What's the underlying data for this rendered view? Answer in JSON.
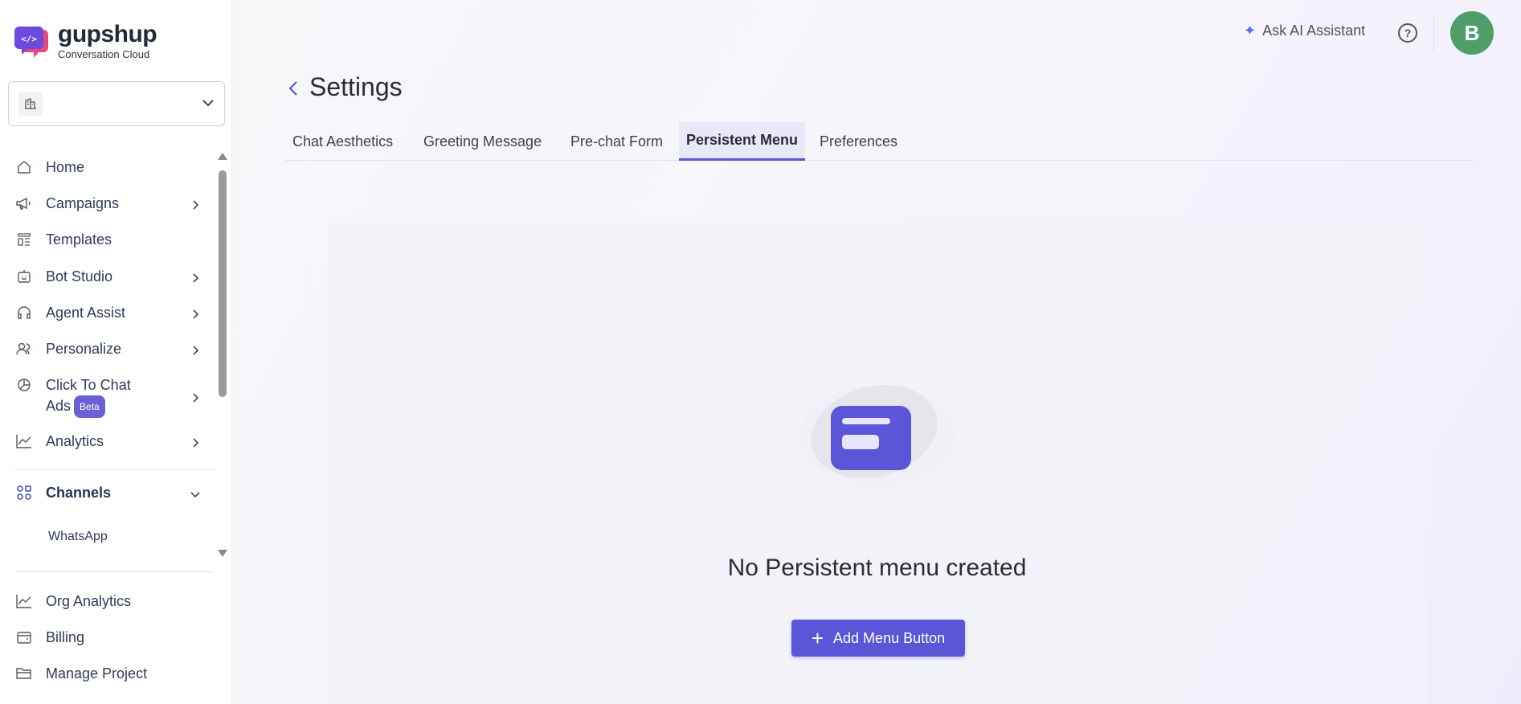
{
  "brand": {
    "name": "gupshup",
    "tagline": "Conversation Cloud",
    "logo_colors": [
      "#6a4bdc",
      "#e8457a"
    ]
  },
  "org_selector": {
    "value": "",
    "icon": "building-icon"
  },
  "sidebar": {
    "items": [
      {
        "label": "Home",
        "icon": "home-icon",
        "has_submenu": false
      },
      {
        "label": "Campaigns",
        "icon": "megaphone-icon",
        "has_submenu": true
      },
      {
        "label": "Templates",
        "icon": "templates-icon",
        "has_submenu": false
      },
      {
        "label": "Bot Studio",
        "icon": "bot-icon",
        "has_submenu": true
      },
      {
        "label": "Agent Assist",
        "icon": "headset-icon",
        "has_submenu": true
      },
      {
        "label": "Personalize",
        "icon": "users-icon",
        "has_submenu": true
      },
      {
        "label_line1": "Click To Chat",
        "label_line2": "Ads",
        "badge": "Beta",
        "icon": "pie-chart-icon",
        "has_submenu": true
      },
      {
        "label": "Analytics",
        "icon": "line-chart-icon",
        "has_submenu": true
      }
    ],
    "channels": {
      "label": "Channels",
      "icon": "channels-icon",
      "expanded": true,
      "sub_items": [
        "WhatsApp"
      ]
    },
    "bottom_items": [
      {
        "label": "Org Analytics",
        "icon": "line-chart-icon"
      },
      {
        "label": "Billing",
        "icon": "wallet-icon"
      },
      {
        "label": "Manage Project",
        "icon": "folder-icon"
      }
    ]
  },
  "header": {
    "ask_ai": "Ask AI Assistant",
    "help_icon": "question-icon",
    "avatar_initial": "B",
    "avatar_color": "#4f9d69"
  },
  "page": {
    "title": "Settings",
    "tabs": [
      {
        "label": "Chat Aesthetics",
        "active": false
      },
      {
        "label": "Greeting Message",
        "active": false
      },
      {
        "label": "Pre-chat Form",
        "active": false
      },
      {
        "label": "Persistent Menu",
        "active": true
      },
      {
        "label": "Preferences",
        "active": false
      }
    ],
    "empty_state": {
      "message": "No Persistent menu created",
      "button_label": "Add Menu Button",
      "illustration": "menu-card-icon"
    },
    "accent_color": "#5b55d8"
  }
}
